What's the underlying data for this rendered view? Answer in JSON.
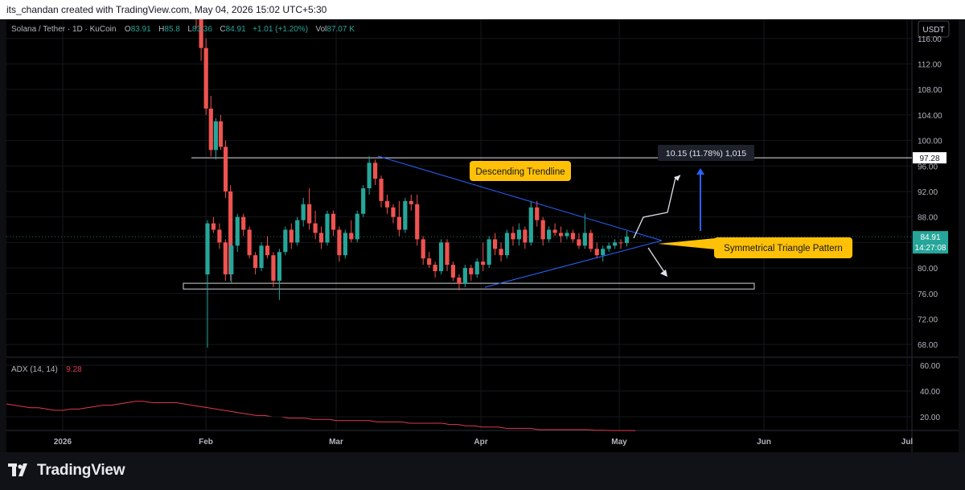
{
  "header": {
    "caption": "its_chandan created with TradingView.com, May 04, 2026 15:02 UTC+5:30"
  },
  "legend": {
    "symbol": "Solana / Tether · 1D · KuCoin",
    "o_label": "O",
    "o_value": "83.91",
    "h_label": "H",
    "h_value": "85.8",
    "l_label": "L",
    "l_value": "83.36",
    "c_label": "C",
    "c_value": "84.91",
    "change": "+1.01 (+1.20%)",
    "vol_label": "Vol",
    "vol_value": "87.07 K"
  },
  "currency_button": "USDT",
  "price_axis": {
    "ticks": [
      "116.00",
      "112.00",
      "108.00",
      "104.00",
      "100.00",
      "96.00",
      "92.00",
      "88.00",
      "84.00",
      "80.00",
      "76.00",
      "72.00",
      "68.00"
    ],
    "level_label": "97.28",
    "last_price": "84.91",
    "countdown": "14:27:08"
  },
  "adx": {
    "label": "ADX (14, 14)",
    "value": "9.28",
    "ticks": [
      "60.00",
      "40.00",
      "20.00"
    ],
    "color": "#e0394f"
  },
  "time_axis": {
    "labels": [
      "2026",
      "Feb",
      "Mar",
      "Apr",
      "May",
      "Jun",
      "Jul"
    ]
  },
  "annotations": {
    "descending_trendline": "Descending Trendline",
    "symmetrical_triangle": "Symmetrical Triangle Pattern",
    "measure": "10.15 (11.78%) 1,015",
    "callout_color": "#ffc107"
  },
  "colors": {
    "up": "#26a69a",
    "down": "#ef5350",
    "trendline": "#2962ff",
    "background": "#000000"
  },
  "footer": {
    "brand": "TradingView"
  },
  "chart_data": {
    "type": "candlestick",
    "symbol": "Solana / Tether",
    "interval": "1D",
    "exchange": "KuCoin",
    "ylim": [
      66,
      119
    ],
    "horizontal_level": 97.28,
    "support_zone": [
      76.7,
      77.6
    ],
    "candles": [
      {
        "o": 121.0,
        "h": 123.0,
        "l": 117.5,
        "c": 119.0
      },
      {
        "o": 119.0,
        "h": 120.0,
        "l": 112.5,
        "c": 114.5
      },
      {
        "o": 114.5,
        "h": 116.0,
        "l": 104.0,
        "c": 105.0
      },
      {
        "o": 105.0,
        "h": 107.0,
        "l": 97.5,
        "c": 98.5
      },
      {
        "o": 98.5,
        "h": 103.5,
        "l": 97.0,
        "c": 103.0
      },
      {
        "o": 103.0,
        "h": 104.0,
        "l": 98.5,
        "c": 99.0
      },
      {
        "o": 99.0,
        "h": 100.0,
        "l": 91.0,
        "c": 92.0
      },
      {
        "o": 92.0,
        "h": 93.0,
        "l": 78.0,
        "c": 79.0
      },
      {
        "o": 79.0,
        "h": 87.5,
        "l": 67.5,
        "c": 87.0
      },
      {
        "o": 87.0,
        "h": 88.0,
        "l": 85.5,
        "c": 86.0
      },
      {
        "o": 86.0,
        "h": 87.0,
        "l": 83.0,
        "c": 84.0
      },
      {
        "o": 84.0,
        "h": 84.5,
        "l": 78.0,
        "c": 79.0
      },
      {
        "o": 79.0,
        "h": 84.0,
        "l": 77.5,
        "c": 83.5
      },
      {
        "o": 83.5,
        "h": 88.5,
        "l": 82.5,
        "c": 88.0
      },
      {
        "o": 88.0,
        "h": 88.5,
        "l": 85.0,
        "c": 86.0
      },
      {
        "o": 86.0,
        "h": 86.5,
        "l": 81.5,
        "c": 82.0
      },
      {
        "o": 82.0,
        "h": 82.5,
        "l": 79.0,
        "c": 80.0
      },
      {
        "o": 80.0,
        "h": 84.0,
        "l": 79.5,
        "c": 83.5
      },
      {
        "o": 83.5,
        "h": 85.0,
        "l": 81.5,
        "c": 82.0
      },
      {
        "o": 82.0,
        "h": 82.5,
        "l": 77.0,
        "c": 78.0
      },
      {
        "o": 78.0,
        "h": 83.0,
        "l": 75.0,
        "c": 82.5
      },
      {
        "o": 82.5,
        "h": 86.5,
        "l": 82.0,
        "c": 86.0
      },
      {
        "o": 86.0,
        "h": 87.0,
        "l": 83.0,
        "c": 84.0
      },
      {
        "o": 84.0,
        "h": 88.0,
        "l": 83.5,
        "c": 87.5
      },
      {
        "o": 87.5,
        "h": 91.0,
        "l": 86.5,
        "c": 90.0
      },
      {
        "o": 90.0,
        "h": 92.5,
        "l": 86.0,
        "c": 87.0
      },
      {
        "o": 87.0,
        "h": 89.0,
        "l": 84.5,
        "c": 85.5
      },
      {
        "o": 85.5,
        "h": 86.5,
        "l": 83.0,
        "c": 84.0
      },
      {
        "o": 84.0,
        "h": 89.0,
        "l": 83.5,
        "c": 88.5
      },
      {
        "o": 88.5,
        "h": 89.0,
        "l": 85.0,
        "c": 86.0
      },
      {
        "o": 86.0,
        "h": 86.5,
        "l": 81.0,
        "c": 82.0
      },
      {
        "o": 82.0,
        "h": 86.0,
        "l": 81.5,
        "c": 85.5
      },
      {
        "o": 85.5,
        "h": 87.5,
        "l": 84.0,
        "c": 84.5
      },
      {
        "o": 84.5,
        "h": 89.0,
        "l": 84.0,
        "c": 88.5
      },
      {
        "o": 88.5,
        "h": 93.0,
        "l": 88.0,
        "c": 92.5
      },
      {
        "o": 92.5,
        "h": 97.5,
        "l": 91.5,
        "c": 96.5
      },
      {
        "o": 96.5,
        "h": 97.0,
        "l": 93.0,
        "c": 94.0
      },
      {
        "o": 94.0,
        "h": 94.5,
        "l": 89.5,
        "c": 90.5
      },
      {
        "o": 90.5,
        "h": 91.5,
        "l": 88.5,
        "c": 89.5
      },
      {
        "o": 89.5,
        "h": 90.0,
        "l": 87.0,
        "c": 88.0
      },
      {
        "o": 88.0,
        "h": 90.5,
        "l": 85.0,
        "c": 86.0
      },
      {
        "o": 86.0,
        "h": 91.0,
        "l": 85.5,
        "c": 90.5
      },
      {
        "o": 90.5,
        "h": 91.5,
        "l": 89.0,
        "c": 90.0
      },
      {
        "o": 90.0,
        "h": 91.5,
        "l": 83.5,
        "c": 84.5
      },
      {
        "o": 84.5,
        "h": 85.0,
        "l": 80.5,
        "c": 81.5
      },
      {
        "o": 81.5,
        "h": 82.5,
        "l": 80.0,
        "c": 80.5
      },
      {
        "o": 80.5,
        "h": 81.0,
        "l": 78.5,
        "c": 79.5
      },
      {
        "o": 79.5,
        "h": 84.5,
        "l": 79.0,
        "c": 84.0
      },
      {
        "o": 84.0,
        "h": 84.5,
        "l": 79.5,
        "c": 80.5
      },
      {
        "o": 80.5,
        "h": 81.0,
        "l": 78.0,
        "c": 78.5
      },
      {
        "o": 78.5,
        "h": 79.0,
        "l": 76.5,
        "c": 77.5
      },
      {
        "o": 77.5,
        "h": 80.5,
        "l": 77.0,
        "c": 80.0
      },
      {
        "o": 80.0,
        "h": 80.5,
        "l": 78.0,
        "c": 79.0
      },
      {
        "o": 79.0,
        "h": 81.5,
        "l": 78.5,
        "c": 81.0
      },
      {
        "o": 81.0,
        "h": 84.0,
        "l": 79.5,
        "c": 80.5
      },
      {
        "o": 80.5,
        "h": 85.0,
        "l": 80.0,
        "c": 84.5
      },
      {
        "o": 84.5,
        "h": 85.5,
        "l": 82.0,
        "c": 83.0
      },
      {
        "o": 83.0,
        "h": 84.0,
        "l": 81.0,
        "c": 82.0
      },
      {
        "o": 82.0,
        "h": 86.0,
        "l": 81.5,
        "c": 85.5
      },
      {
        "o": 85.5,
        "h": 86.5,
        "l": 83.5,
        "c": 84.5
      },
      {
        "o": 84.5,
        "h": 87.0,
        "l": 83.5,
        "c": 86.0
      },
      {
        "o": 86.0,
        "h": 86.5,
        "l": 83.0,
        "c": 84.0
      },
      {
        "o": 84.0,
        "h": 90.5,
        "l": 83.5,
        "c": 89.5
      },
      {
        "o": 89.5,
        "h": 90.5,
        "l": 86.5,
        "c": 87.5
      },
      {
        "o": 87.5,
        "h": 88.0,
        "l": 83.5,
        "c": 84.5
      },
      {
        "o": 84.5,
        "h": 86.5,
        "l": 84.0,
        "c": 86.0
      },
      {
        "o": 86.0,
        "h": 87.0,
        "l": 85.0,
        "c": 85.5
      },
      {
        "o": 85.5,
        "h": 86.5,
        "l": 84.0,
        "c": 85.0
      },
      {
        "o": 85.0,
        "h": 86.0,
        "l": 84.5,
        "c": 85.5
      },
      {
        "o": 85.5,
        "h": 86.0,
        "l": 84.0,
        "c": 84.5
      },
      {
        "o": 84.5,
        "h": 85.5,
        "l": 83.0,
        "c": 83.5
      },
      {
        "o": 83.5,
        "h": 88.5,
        "l": 83.0,
        "c": 85.5
      },
      {
        "o": 85.5,
        "h": 86.0,
        "l": 82.5,
        "c": 83.0
      },
      {
        "o": 83.0,
        "h": 84.0,
        "l": 81.5,
        "c": 82.0
      },
      {
        "o": 82.0,
        "h": 83.5,
        "l": 81.0,
        "c": 83.0
      },
      {
        "o": 83.0,
        "h": 84.0,
        "l": 82.5,
        "c": 83.5
      },
      {
        "o": 83.5,
        "h": 84.5,
        "l": 83.0,
        "c": 84.0
      },
      {
        "o": 84.0,
        "h": 84.5,
        "l": 83.0,
        "c": 83.9
      },
      {
        "o": 83.91,
        "h": 85.8,
        "l": 83.36,
        "c": 84.91
      }
    ],
    "adx": {
      "name": "ADX (14, 14)",
      "ylim": [
        10,
        65
      ],
      "values": [
        30,
        29,
        28,
        27,
        27,
        26,
        25,
        25,
        26,
        26,
        27,
        28,
        29,
        29,
        30,
        31,
        32,
        32,
        31,
        31,
        31,
        31,
        30,
        29,
        28,
        27,
        26,
        25,
        24,
        23,
        22,
        21,
        21,
        20,
        20,
        19,
        19,
        19,
        18,
        18,
        18,
        17,
        17,
        17,
        17,
        17,
        16,
        16,
        16,
        16,
        15,
        15,
        15,
        15,
        15,
        14,
        14,
        13,
        13,
        12,
        12,
        12,
        11,
        11,
        11,
        11,
        10,
        10,
        10,
        10,
        10,
        10,
        10,
        9.5,
        9.5,
        9.3,
        9.3,
        9.3,
        9.28
      ]
    }
  }
}
